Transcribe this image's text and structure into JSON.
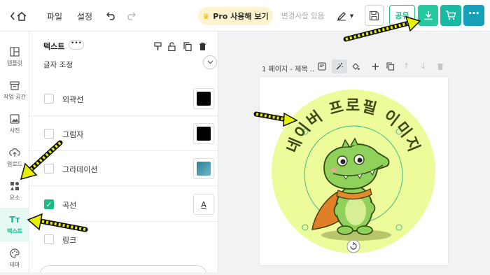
{
  "header": {
    "menu_file": "파일",
    "menu_settings": "설정",
    "pro_button": "Pro 사용해 보기",
    "changes_status": "변경사항 있음",
    "share_label": "공유"
  },
  "sidebar": {
    "items": [
      {
        "label": "템플릿",
        "icon": "template-icon"
      },
      {
        "label": "작업 공간",
        "icon": "workspace-icon"
      },
      {
        "label": "사진",
        "icon": "photo-icon"
      },
      {
        "label": "업로드",
        "icon": "upload-icon"
      },
      {
        "label": "요소",
        "icon": "elements-icon"
      },
      {
        "label": "텍스트",
        "icon": "text-icon"
      },
      {
        "label": "테마",
        "icon": "theme-icon"
      }
    ],
    "active": "텍스트"
  },
  "panel": {
    "title": "텍스트",
    "section_label": "글자 조정",
    "options": [
      {
        "label": "외곽선",
        "checked": false,
        "swatch": "#000000"
      },
      {
        "label": "그림자",
        "checked": false,
        "swatch": "#000000"
      },
      {
        "label": "그라데이션",
        "checked": false,
        "swatch": "#3a8ea0"
      },
      {
        "label": "곡선",
        "checked": true,
        "swatch": "A"
      },
      {
        "label": "링크",
        "checked": false
      }
    ]
  },
  "canvas": {
    "page_label": "1 페이지 - 제목 ..",
    "curved_text": "네이버 프로필 이미지",
    "circle_color": "#eefb9a"
  },
  "colors": {
    "accent": "#1eb985",
    "download_bg": "#27c9a0",
    "cart_bg": "#19b9a4",
    "annotation_arrow": "#e8f000"
  }
}
